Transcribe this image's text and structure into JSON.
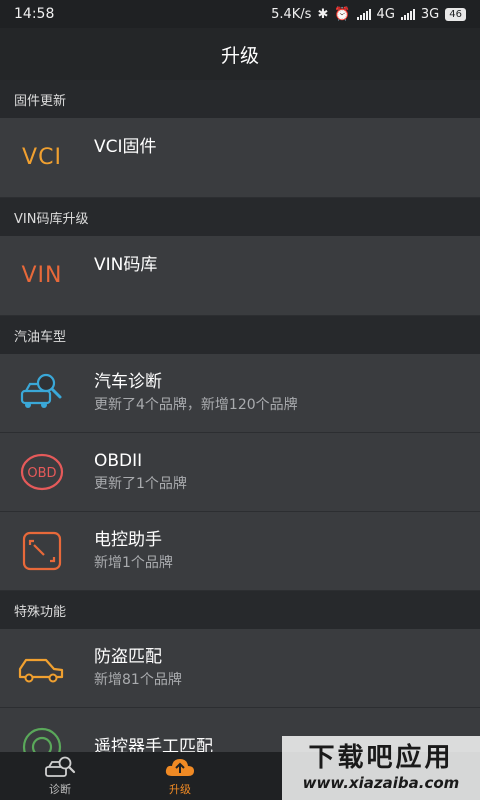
{
  "status": {
    "time": "14:58",
    "speed": "5.4K/s",
    "net1": "4G",
    "net2": "3G",
    "battery": "46"
  },
  "header": {
    "title": "升级"
  },
  "sections": [
    {
      "header": "固件更新",
      "items": [
        {
          "title": "VCI固件",
          "icon": "vci-icon",
          "icon_text": "VCI",
          "color": "#f0a030"
        }
      ]
    },
    {
      "header": "VIN码库升级",
      "items": [
        {
          "title": "VIN码库",
          "icon": "vin-icon",
          "icon_text": "VIN",
          "color": "#e8693a"
        }
      ]
    },
    {
      "header": "汽油车型",
      "items": [
        {
          "title": "汽车诊断",
          "subtitle": "更新了4个品牌，新增120个品牌",
          "icon": "car-diagnosis-icon",
          "color": "#3aa8d8"
        },
        {
          "title": "OBDII",
          "subtitle": "更新了1个品牌",
          "icon": "obd-icon",
          "icon_text": "OBD",
          "color": "#e55a5a"
        },
        {
          "title": "电控助手",
          "subtitle": "新增1个品牌",
          "icon": "ecu-assistant-icon",
          "color": "#e8693a"
        }
      ]
    },
    {
      "header": "特殊功能",
      "items": [
        {
          "title": "防盗匹配",
          "subtitle": "新增81个品牌",
          "icon": "anti-theft-car-key-icon",
          "color": "#f0a030"
        },
        {
          "title": "遥控器手工匹配",
          "icon": "remote-icon",
          "color": "#5aa85a"
        }
      ]
    }
  ],
  "nav": [
    {
      "label": "诊断",
      "icon": "diagnosis-nav-icon"
    },
    {
      "label": "升级",
      "icon": "upgrade-cloud-icon",
      "active": true,
      "color": "#f08a24"
    }
  ],
  "watermark": {
    "cn": "下载吧应用",
    "en": "www.xiazaiba.com"
  }
}
